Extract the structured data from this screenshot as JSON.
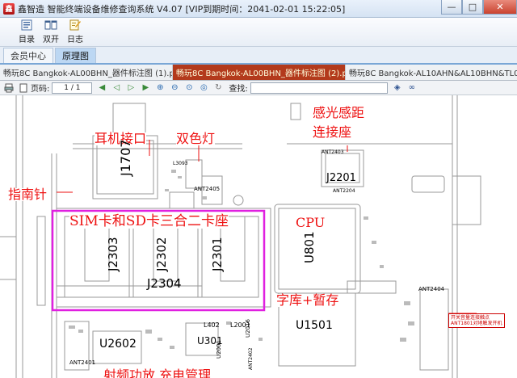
{
  "window": {
    "title": "鑫智造 智能终端设备维修查询系统 V4.07 [VIP到期时间：2041-02-01 15:22:05]",
    "app_glyph": "鑫",
    "min": "—",
    "max": "□",
    "close": "✕"
  },
  "toolbar": {
    "buttons": [
      {
        "label": "目录",
        "icon": "catalog-icon"
      },
      {
        "label": "双开",
        "icon": "dual-open-icon"
      },
      {
        "label": "日志",
        "icon": "log-icon"
      }
    ]
  },
  "nav_tabs": [
    {
      "label": "会员中心",
      "active": false
    },
    {
      "label": "原理图",
      "active": true
    }
  ],
  "doc_tabs": [
    {
      "label": "畅玩8C Bangkok-AL00BHN_器件标注图 (1).pdf",
      "active": false,
      "close": "✕"
    },
    {
      "label": "畅玩8C Bangkok-AL00BHN_器件标注图 (2).pdf",
      "active": true,
      "close": "✕"
    },
    {
      "label": "畅玩8C Bangkok-AL10AHN&AL10BHN&TL00...",
      "active": false
    }
  ],
  "pdf_toolbar": {
    "page_label": "页码:",
    "page_value": "1 / 1",
    "find_label": "查找:",
    "find_value": ""
  },
  "schematic": {
    "labels": {
      "headphone": "耳机接口",
      "dual_led": "双色灯",
      "light_sensor": "感光感距",
      "sensor_connector": "连接座",
      "compass": "指南针",
      "sim_sd": "SIM卡和SD卡三合二卡座",
      "cpu": "CPU",
      "font_storage": "字库+暂存",
      "bottom_cut": "射频功放 充电管理"
    },
    "components": {
      "j1707": "J1707",
      "j2303": "J2303",
      "j2302": "J2302",
      "j2301": "J2301",
      "j2304": "J2304",
      "j2201": "J2201",
      "u801": "U801",
      "u1501": "U1501",
      "u2602": "U2602",
      "u301": "U301",
      "ant2405": "ANT2405",
      "ant2403": "ANT2403",
      "ant2404": "ANT2404",
      "ant2401": "ANT2401",
      "ant2402": "ANT2402",
      "l3093": "L3093",
      "l402": "L402",
      "l2001": "L2001",
      "u2016": "U2016",
      "u2001": "U2001",
      "ant2204": "ANT2204"
    },
    "note_lines": [
      "开关音量连接触点",
      "ANT1801对地触发开机"
    ]
  },
  "colors": {
    "annotation_red": "#e11111",
    "highlight_magenta": "#e020e0",
    "active_doc_tab": "#b33a1c",
    "active_nav_tab": "#bcd7f3"
  }
}
